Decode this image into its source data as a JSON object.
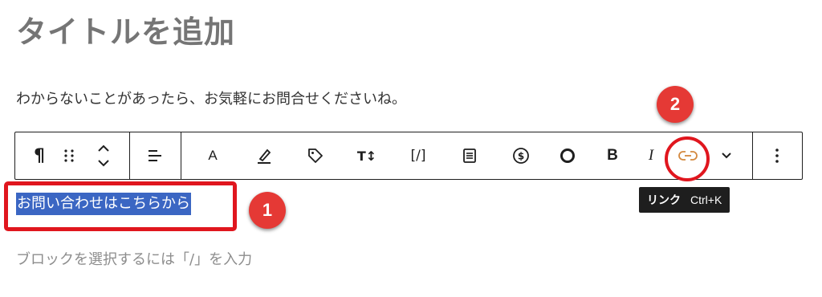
{
  "editor": {
    "title_placeholder": "タイトルを追加",
    "paragraph": "わからないことがあったら、お気軽にお問合せくださいね。",
    "selected_text": "お問い合わせはこちらから",
    "block_placeholder": "ブロックを選択するには「/」を入力"
  },
  "toolbar": {
    "buttons": [
      {
        "icon": "paragraph-icon",
        "glyph": "¶"
      },
      {
        "icon": "drag-handle-icon"
      },
      {
        "icon": "move-up-down-icon"
      },
      {
        "icon": "align-left-icon"
      },
      {
        "icon": "font-icon",
        "glyph": "A"
      },
      {
        "icon": "highlighter-icon"
      },
      {
        "icon": "tag-icon"
      },
      {
        "icon": "text-size-icon",
        "glyph": "T↕"
      },
      {
        "icon": "shortcode-icon",
        "glyph": "[/]"
      },
      {
        "icon": "document-icon"
      },
      {
        "icon": "dollar-icon"
      },
      {
        "icon": "circle-icon"
      },
      {
        "icon": "bold-icon",
        "glyph": "B"
      },
      {
        "icon": "italic-icon",
        "glyph": "I"
      },
      {
        "icon": "link-icon"
      },
      {
        "icon": "chevron-down-icon"
      },
      {
        "icon": "more-options-icon"
      }
    ]
  },
  "tooltip": {
    "label": "リンク",
    "shortcut": "Ctrl+K"
  },
  "annotations": {
    "badge_1": "1",
    "badge_2": "2",
    "highlight_color": "#e0161e"
  },
  "colors": {
    "selection": "#3b66c3",
    "link_icon": "#d4893f"
  }
}
